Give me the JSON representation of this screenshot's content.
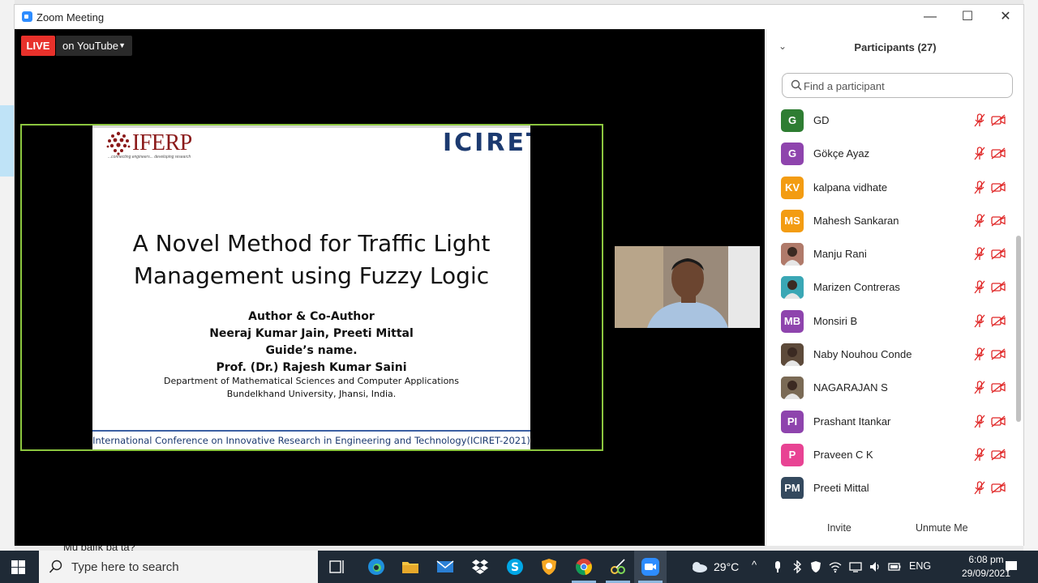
{
  "window": {
    "title": "Zoom Meeting"
  },
  "live": {
    "badge": "LIVE",
    "destination": "on YouTube"
  },
  "slide": {
    "logo_left": "IFERP",
    "logo_left_tagline": "...connecting engineers... developing research",
    "logo_right": "ICIRET",
    "title_line1": "A Novel Method for Traffic Light",
    "title_line2": "Management using Fuzzy Logic",
    "authors_heading": "Author & Co-Author",
    "authors": "Neeraj Kumar Jain, Preeti Mittal",
    "guide_heading": "Guide’s name.",
    "guide": "Prof. (Dr.) Rajesh Kumar Saini",
    "department": "Department of Mathematical Sciences and Computer Applications",
    "university": "Bundelkhand University, Jhansi, India.",
    "footer": "International Conference on Innovative Research in Engineering and Technology(ICIRET-2021)"
  },
  "participants_panel": {
    "title": "Participants (27)",
    "search_placeholder": "Find a participant",
    "participants": [
      {
        "initials": "G",
        "name": "GD",
        "color": "#2e7d32",
        "photo": false
      },
      {
        "initials": "G",
        "name": "Gökçe Ayaz",
        "color": "#8e44ad",
        "photo": false
      },
      {
        "initials": "KV",
        "name": "kalpana vidhate",
        "color": "#f39c12",
        "photo": false
      },
      {
        "initials": "MS",
        "name": "Mahesh Sankaran",
        "color": "#f39c12",
        "photo": false
      },
      {
        "initials": "",
        "name": "Manju Rani",
        "color": "#b07a6a",
        "photo": true
      },
      {
        "initials": "",
        "name": "Marizen Contreras",
        "color": "#3aa7b5",
        "photo": true
      },
      {
        "initials": "MB",
        "name": "Monsiri B",
        "color": "#8e44ad",
        "photo": false
      },
      {
        "initials": "",
        "name": "Naby Nouhou Conde",
        "color": "#5d4a3a",
        "photo": true
      },
      {
        "initials": "",
        "name": "NAGARAJAN S",
        "color": "#7a6a55",
        "photo": true
      },
      {
        "initials": "PI",
        "name": "Prashant Itankar",
        "color": "#8e44ad",
        "photo": false
      },
      {
        "initials": "P",
        "name": "Praveen C K",
        "color": "#e84393",
        "photo": false
      },
      {
        "initials": "PM",
        "name": "Preeti Mittal",
        "color": "#34495e",
        "photo": false
      }
    ],
    "invite_label": "Invite",
    "unmute_label": "Unmute Me"
  },
  "background": {
    "chat_snippet": "Mu balık pa ta?"
  },
  "taskbar": {
    "search_placeholder": "Type here to search",
    "weather": "29°C",
    "language": "ENG",
    "time": "6:08 pm",
    "date": "29/09/2021"
  },
  "colors": {
    "live_red": "#e8312b",
    "share_border": "#8cc63f",
    "taskbar": "#1f2a36",
    "muted_red": "#e02828"
  }
}
